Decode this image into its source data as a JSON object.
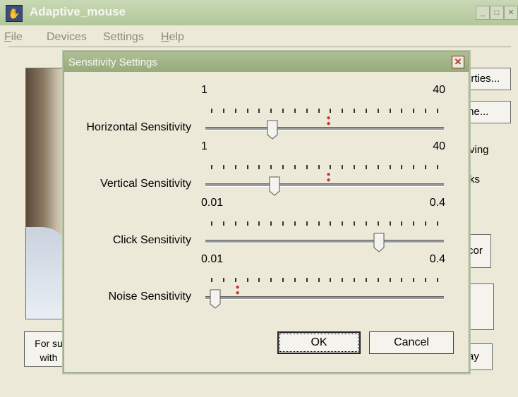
{
  "window": {
    "title": "Adaptive_mouse"
  },
  "menu": [
    {
      "label": "File",
      "ul": "F",
      "rest": "ile"
    },
    {
      "label": "Devices",
      "ul": "",
      "rest": "Devices"
    },
    {
      "label": "Settings",
      "ul": "",
      "rest": "Settings"
    },
    {
      "label": "Help",
      "ul": "H",
      "rest": "elp"
    }
  ],
  "background": {
    "status_line1": "For su",
    "status_line2": "with",
    "btn_properties": "erties...",
    "btn_frame": "me...",
    "text_ving": "ving",
    "text_ks": "ks",
    "btn_cor": "cor",
    "btn_ay": "ay"
  },
  "dialog": {
    "title": "Sensitivity Settings",
    "close_glyph": "✕",
    "ok_label": "OK",
    "cancel_label": "Cancel",
    "sliders": [
      {
        "label": "Horizontal Sensitivity",
        "min": "1",
        "max": "40",
        "value_fraction": 0.27,
        "marker_fraction": 0.52
      },
      {
        "label": "Vertical Sensitivity",
        "min": "1",
        "max": "40",
        "value_fraction": 0.28,
        "marker_fraction": 0.52
      },
      {
        "label": "Click Sensitivity",
        "min": "0.01",
        "max": "0.4",
        "value_fraction": 0.74,
        "marker_fraction": null
      },
      {
        "label": "Noise Sensitivity",
        "min": "0.01",
        "max": "0.4",
        "value_fraction": 0.02,
        "marker_fraction": 0.12
      }
    ]
  },
  "colors": {
    "marker": "#d03030",
    "titlebar": "#b3c79a"
  }
}
